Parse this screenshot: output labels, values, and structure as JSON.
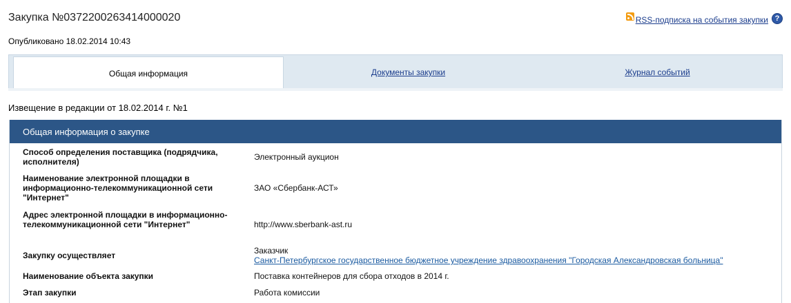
{
  "page": {
    "title": "Закупка №0372200263414000020",
    "published": "Опубликовано 18.02.2014 10:43",
    "rss_link": "RSS-подписка на события закупки",
    "help_glyph": "?"
  },
  "tabs": [
    {
      "label": "Общая информация",
      "active": true
    },
    {
      "label": "Документы закупки",
      "active": false
    },
    {
      "label": "Журнал событий",
      "active": false
    }
  ],
  "notice": "Извещение в редакции от 18.02.2014 г. №1",
  "panel": {
    "header": "Общая информация о закупке",
    "rows": [
      {
        "label": "Способ определения поставщика (подрядчика, исполнителя)",
        "value": "Электронный аукцион"
      },
      {
        "label": "Наименование электронной площадки в информационно-телекоммуникационной сети \"Интернет\"",
        "value": "ЗАО «Сбербанк-АСТ»"
      },
      {
        "label": "Адрес электронной площадки в информационно-телекоммуникационной сети \"Интернет\"",
        "value": "http://www.sberbank-ast.ru"
      },
      {
        "label": "Закупку осуществляет",
        "value": "Заказчик",
        "value_link": "Санкт-Петербургское государственное бюджетное учреждение здравоохранения \"Городская Александровская больница\""
      },
      {
        "label": "Наименование объекта закупки",
        "value": "Поставка контейнеров для сбора отходов в 2014 г."
      },
      {
        "label": "Этап закупки",
        "value": "Работа комиссии"
      }
    ]
  },
  "colors": {
    "header_bg": "#2c5687",
    "tab_bg": "#dfe9f1",
    "link": "#1a3c8c",
    "rss_orange": "#f39c12"
  },
  "icons": {
    "rss": "rss-icon",
    "help": "help-icon"
  }
}
